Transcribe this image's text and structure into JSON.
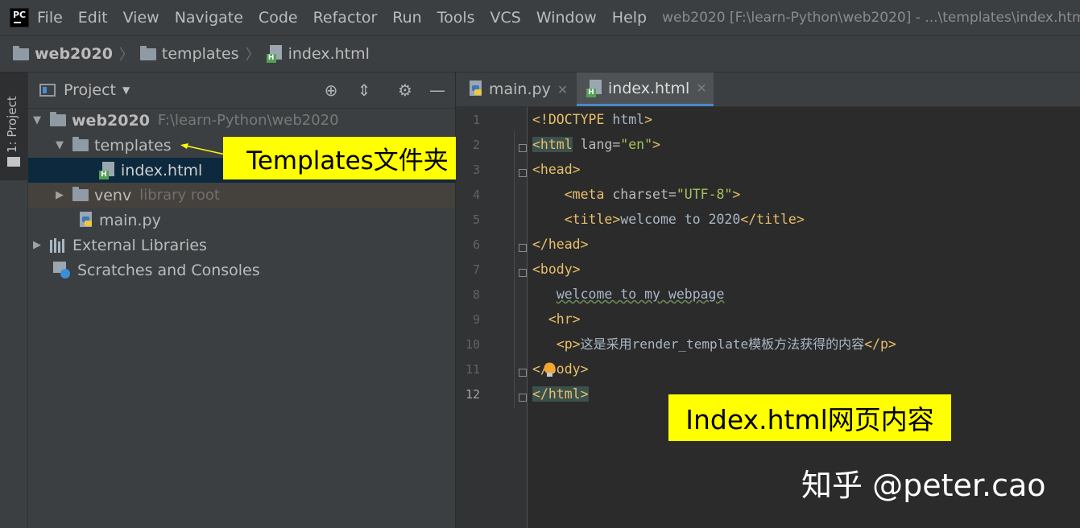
{
  "app": {
    "logo_text": "PC",
    "menu": [
      "File",
      "Edit",
      "View",
      "Navigate",
      "Code",
      "Refactor",
      "Run",
      "Tools",
      "VCS",
      "Window",
      "Help"
    ],
    "window_title": "web2020 [F:\\learn-Python\\web2020] - ...\\templates\\index.html"
  },
  "breadcrumb": [
    "web2020",
    "templates",
    "index.html"
  ],
  "tool_strip": {
    "project_label": "1: Project"
  },
  "project_panel": {
    "title": "Project",
    "tree": [
      {
        "label": "web2020",
        "hint": "F:\\learn-Python\\web2020"
      },
      {
        "label": "templates"
      },
      {
        "label": "index.html"
      },
      {
        "label": "venv",
        "hint": "library root"
      },
      {
        "label": "main.py"
      },
      {
        "label": "External Libraries"
      },
      {
        "label": "Scratches and Consoles"
      }
    ]
  },
  "editor_tabs": [
    "main.py",
    "index.html"
  ],
  "editor": {
    "line_numbers": [
      "1",
      "2",
      "3",
      "4",
      "5",
      "6",
      "7",
      "8",
      "9",
      "10",
      "11",
      "12"
    ],
    "lines": [
      {
        "indent": "",
        "tag1": "<!DOCTYPE",
        "text": " html",
        "tag2": ">"
      },
      {
        "indent": "",
        "tag1": "<html",
        "attr": " lang=",
        "val": "\"en\"",
        "tag2": ">"
      },
      {
        "indent": "",
        "tag1": "<head>"
      },
      {
        "indent": "    ",
        "tag1": "<meta",
        "attr": " charset=",
        "val": "\"UTF-8\"",
        "tag2": ">"
      },
      {
        "indent": "    ",
        "tag1": "<title>",
        "text": "welcome to 2020",
        "tag2": "</title>"
      },
      {
        "indent": "",
        "tag1": "</head>"
      },
      {
        "indent": "",
        "tag1": "<body>"
      },
      {
        "indent": "   ",
        "text": "welcome to my webpage"
      },
      {
        "indent": "  ",
        "tag1": "<hr>"
      },
      {
        "indent": "   ",
        "tag1": "<p>",
        "text": "这是采用render_template模板方法获得的内容",
        "tag2": "</p>"
      },
      {
        "indent": "",
        "tag1": "</body>"
      },
      {
        "indent": "",
        "tag1": "</html>"
      }
    ]
  },
  "annotations": {
    "templates_folder": "Templates文件夹",
    "index_content": "Index.html网页内容"
  },
  "watermark": "知乎 @peter.cao"
}
